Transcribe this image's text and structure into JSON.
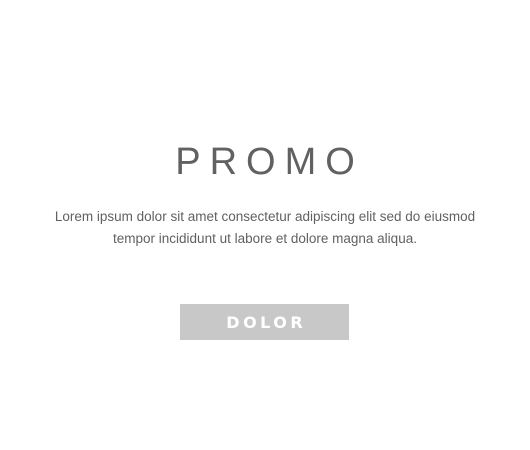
{
  "promo": {
    "title": "PROMO",
    "body": "Lorem ipsum dolor sit amet consectetur adipiscing elit sed do eiusmod tempor incididunt ut labore et dolore magna aliqua.",
    "button_label": "DOLOR"
  },
  "colors": {
    "background": "#ffffff",
    "text": "#616161",
    "button_background": "#c8c8c8",
    "button_text": "#ffffff"
  }
}
